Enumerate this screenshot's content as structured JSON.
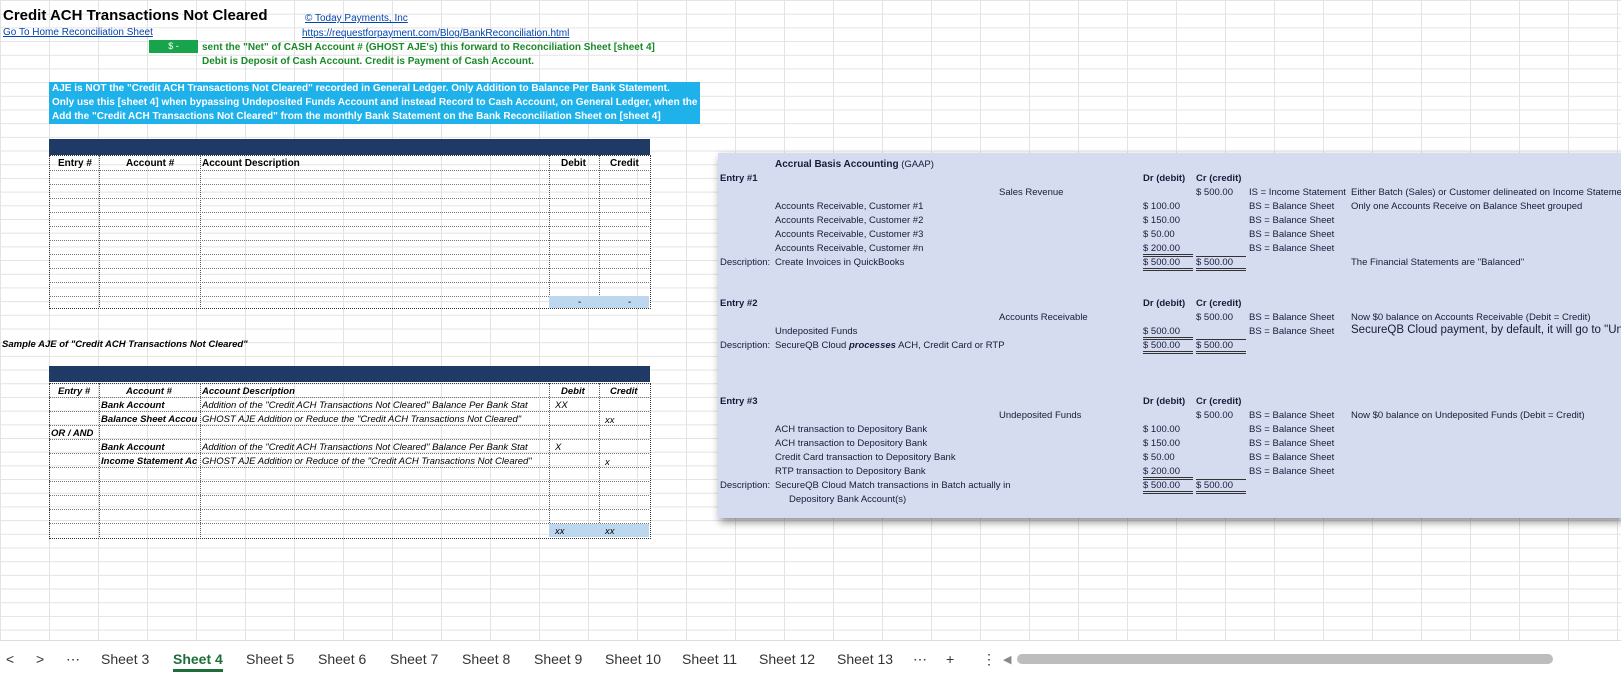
{
  "header": {
    "title": "Credit ACH Transactions Not Cleared",
    "copyright": "© Today Payments, Inc",
    "home_link": "Go To Home Reconciliation Sheet",
    "url": "https://requestforpayment.com/Blog/BankReconciliation.html",
    "amount_cell": "$ -",
    "note_line1": "sent the \"Net\" of CASH Account # (GHOST AJE's) this forward to Reconciliation Sheet [sheet 4]",
    "note_line2": "Debit is Deposit of Cash Account.  Credit is Payment of Cash Account."
  },
  "info_box": [
    "AJE is NOT the \"Credit ACH Transactions Not Cleared\" recorded in General Ledger.  Only Addition to Balance Per Bank Statement.",
    "Only use this [sheet 4] when bypassing Undeposited Funds Account and instead Record to Cash Account, on General Ledger, when the Deposit",
    "Add the \"Credit ACH Transactions Not Cleared\" from the monthly Bank Statement on the Bank Reconciliation Sheet on [sheet 4]"
  ],
  "table1": {
    "headers": [
      "Entry #",
      "Account #",
      "Account Description",
      "Debit",
      "Credit"
    ],
    "totals": [
      "-",
      "-"
    ]
  },
  "sample_label": "Sample AJE of \"Credit ACH Transactions Not Cleared\"",
  "table2": {
    "headers": [
      "Entry #",
      "Account #",
      "Account Description",
      "Debit",
      "Credit"
    ],
    "or_and": "OR / AND",
    "rows": [
      {
        "account": "Bank Account",
        "desc": "Addition of the \"Credit ACH Transactions Not Cleared\" Balance Per Bank Stat",
        "debit": "XX",
        "credit": ""
      },
      {
        "account": "Balance Sheet Accou",
        "desc": "GHOST AJE Addition or Reduce the \"Credit ACH Transactions Not Cleared\"",
        "debit": "",
        "credit": "xx"
      },
      {
        "account": "Bank Account",
        "desc": "Addition of the \"Credit ACH Transactions Not Cleared\" Balance Per Bank Stat",
        "debit": "X",
        "credit": ""
      },
      {
        "account": "Income Statement Ac",
        "desc": "GHOST AJE Addition or Reduce of the \"Credit ACH Transactions Not Cleared\"",
        "debit": "",
        "credit": "x"
      }
    ],
    "totals": [
      "xx",
      "xx"
    ]
  },
  "panel": {
    "title": "Accrual Basis Accounting",
    "title_suffix": "(GAAP)",
    "dr_label": "Dr (debit)",
    "cr_label": "Cr (credit)",
    "desc_label": "Description:",
    "entry1": {
      "label": "Entry #1",
      "credit_account": "Sales Revenue",
      "credit_amount": "$    500.00",
      "credit_note": "IS = Income Statement",
      "right_note1": "Either Batch (Sales) or Customer delineated on Income Stateme",
      "right_note2": "Only one Accounts Receive on Balance Sheet grouped",
      "lines": [
        {
          "acct": "Accounts Receivable, Customer #1",
          "amt": "$    100.00",
          "bs": "BS = Balance Sheet"
        },
        {
          "acct": "Accounts Receivable, Customer #2",
          "amt": "$    150.00",
          "bs": "BS = Balance Sheet"
        },
        {
          "acct": "Accounts Receivable, Customer #3",
          "amt": "$      50.00",
          "bs": "BS = Balance Sheet"
        },
        {
          "acct": "Accounts Receivable, Customer #n",
          "amt": "$    200.00",
          "bs": "BS = Balance Sheet"
        }
      ],
      "description": "Create Invoices in QuickBooks",
      "total_dr": "$    500.00",
      "total_cr": "$    500.00",
      "balanced_note": "The Financial Statements are \"Balanced\""
    },
    "entry2": {
      "label": "Entry #2",
      "credit_account": "Accounts Receivable",
      "credit_amount": "$    500.00",
      "credit_bs": "BS = Balance Sheet",
      "debit_account": "Undeposited Funds",
      "debit_amount": "$    500.00",
      "debit_bs": "BS = Balance Sheet",
      "description_pre": "SecureQB Cloud ",
      "description_em": "processes",
      "description_post": " ACH, Credit Card or RTP",
      "total_dr": "$    500.00",
      "total_cr": "$    500.00",
      "note1": "Now $0 balance on Accounts Receivable (Debit = Credit)",
      "note2": "SecureQB Cloud payment, by default, it will go to \"Un"
    },
    "entry3": {
      "label": "Entry #3",
      "credit_account": "Undeposited Funds",
      "credit_amount": "$    500.00",
      "credit_bs": "BS = Balance Sheet",
      "note": "Now $0 balance on Undeposited Funds (Debit = Credit)",
      "lines": [
        {
          "acct": "ACH transaction to Depository Bank",
          "amt": "$    100.00",
          "bs": "BS = Balance Sheet"
        },
        {
          "acct": "ACH transaction to Depository Bank",
          "amt": "$    150.00",
          "bs": "BS = Balance Sheet"
        },
        {
          "acct": "Credit Card transaction to Depository Bank",
          "amt": "$      50.00",
          "bs": "BS = Balance Sheet"
        },
        {
          "acct": "RTP transaction to Depository Bank",
          "amt": "$    200.00",
          "bs": "BS = Balance Sheet"
        }
      ],
      "description1": "SecureQB Cloud Match transactions in Batch actually in",
      "description2": "Depository Bank Account(s)",
      "total_dr": "$    500.00",
      "total_cr": "$    500.00"
    }
  },
  "tabs": {
    "prev": "<",
    "next": ">",
    "more_left": "⋯",
    "items": [
      "Sheet 3",
      "Sheet 4",
      "Sheet 5",
      "Sheet 6",
      "Sheet 7",
      "Sheet 8",
      "Sheet 9",
      "Sheet 10",
      "Sheet 11",
      "Sheet 12",
      "Sheet 13"
    ],
    "active": "Sheet 4",
    "more_right": "⋯",
    "add": "+",
    "menu": "⋮",
    "scroll_left": "◀"
  }
}
